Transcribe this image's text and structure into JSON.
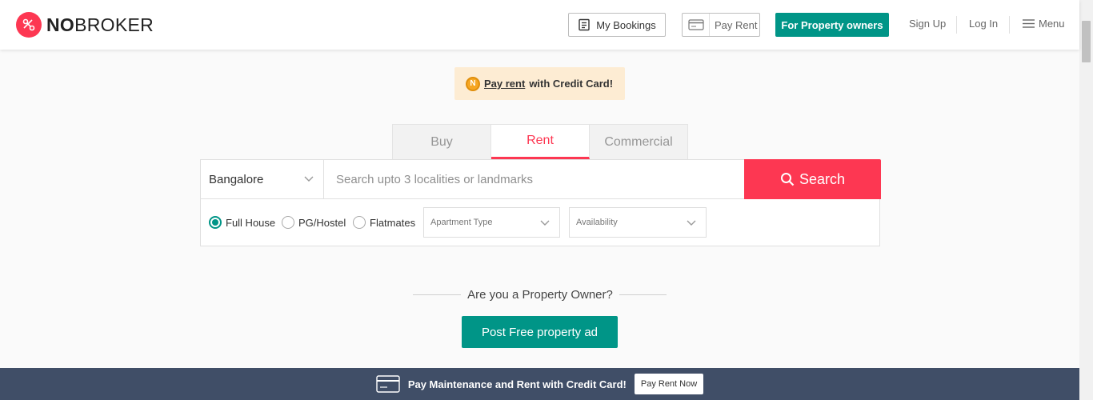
{
  "header": {
    "brand_bold": "NO",
    "brand_rest": "BROKER",
    "my_bookings": "My Bookings",
    "pay_rent": "Pay Rent",
    "for_owners": "For Property owners",
    "sign_up": "Sign Up",
    "log_in": "Log In",
    "menu": "Menu"
  },
  "banner": {
    "coin": "N",
    "link": "Pay rent",
    "text": "with Credit Card!"
  },
  "tabs": [
    {
      "label": "Buy",
      "active": false
    },
    {
      "label": "Rent",
      "active": true
    },
    {
      "label": "Commercial",
      "active": false
    }
  ],
  "search": {
    "city": "Bangalore",
    "placeholder": "Search upto 3 localities or landmarks",
    "button": "Search"
  },
  "filters": {
    "radios": [
      {
        "label": "Full House",
        "selected": true
      },
      {
        "label": "PG/Hostel",
        "selected": false
      },
      {
        "label": "Flatmates",
        "selected": false
      }
    ],
    "apartment_type": "Apartment Type",
    "availability": "Availability"
  },
  "owner": {
    "question": "Are you a Property Owner?",
    "post_button": "Post Free property ad"
  },
  "strip": {
    "text": "Pay Maintenance and Rent with Credit Card!",
    "button": "Pay Rent Now"
  },
  "colors": {
    "brand_red": "#fd3752",
    "teal": "#009587",
    "strip_bg": "#404e67",
    "banner_bg": "#fdecd3"
  },
  "icons": [
    "nobroker-logo-icon",
    "bookings-icon",
    "card-icon",
    "menu-icon",
    "chevron-down-icon",
    "search-icon",
    "credit-card-icon"
  ]
}
